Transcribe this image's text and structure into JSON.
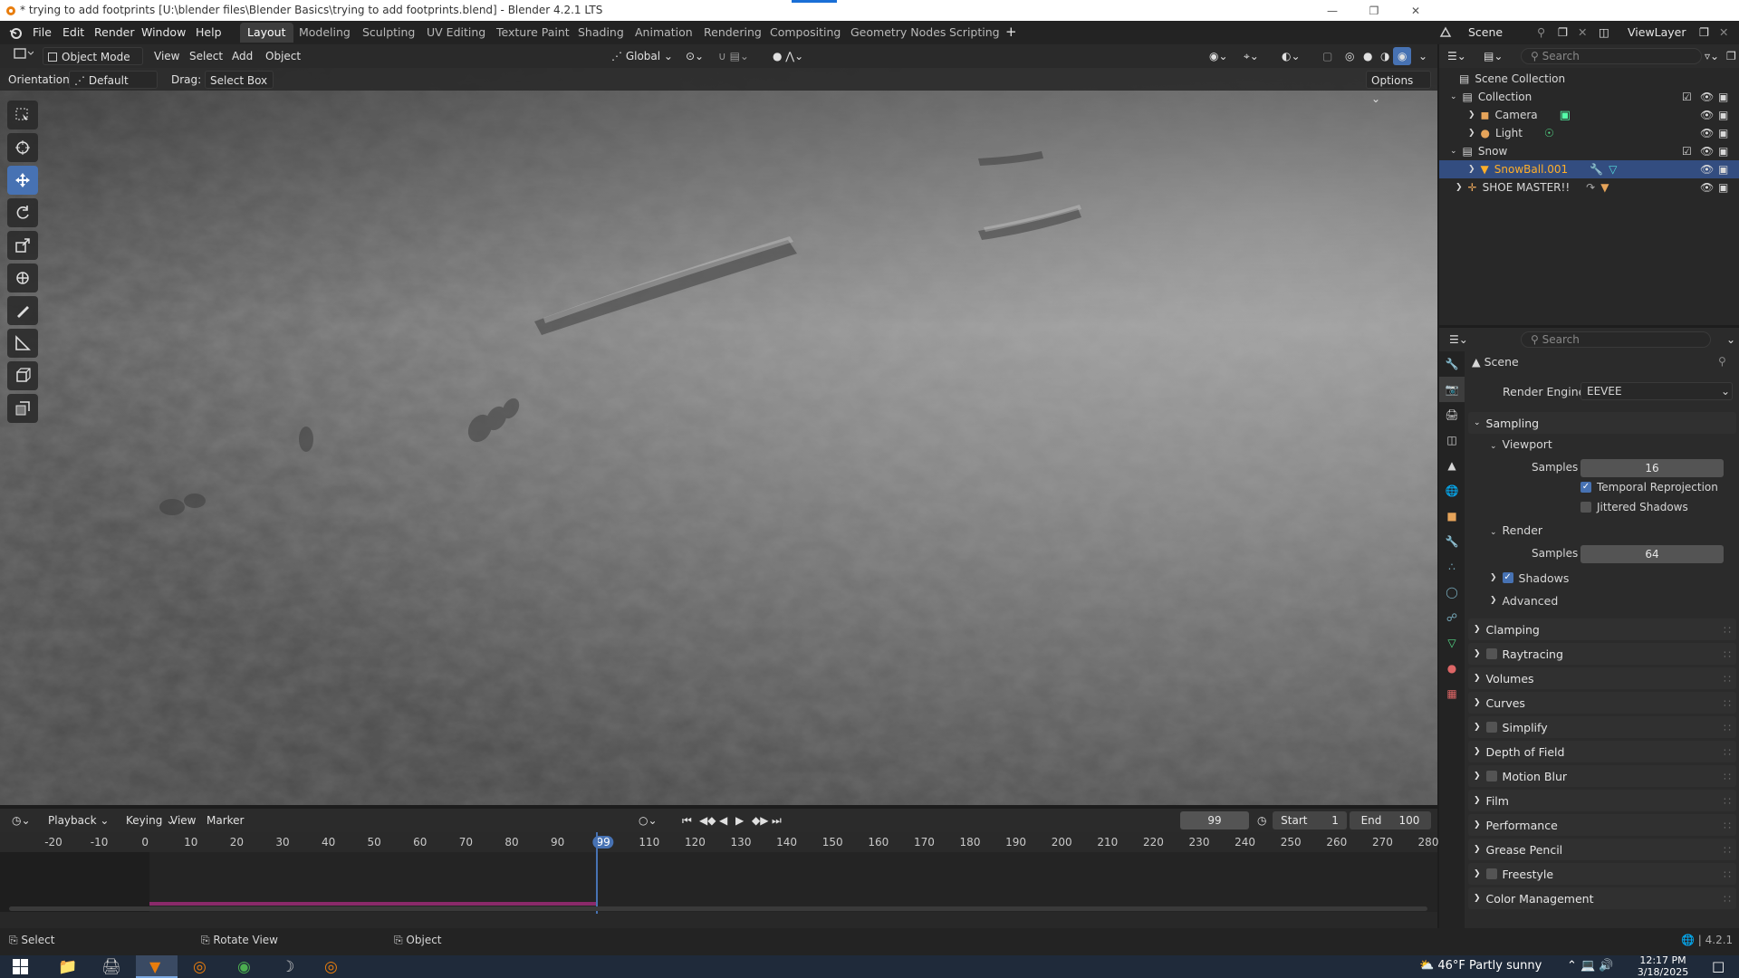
{
  "title_bar": {
    "title": "* trying to add footprints [U:\\blender files\\Blender Basics\\trying to add footprints.blend] - Blender 4.2.1 LTS"
  },
  "menu": [
    "File",
    "Edit",
    "Render",
    "Window",
    "Help"
  ],
  "workspaces": [
    "Layout",
    "Modeling",
    "Sculpting",
    "UV Editing",
    "Texture Paint",
    "Shading",
    "Animation",
    "Rendering",
    "Compositing",
    "Geometry Nodes",
    "Scripting"
  ],
  "scene_selector": {
    "scene": "Scene",
    "view_layer": "ViewLayer"
  },
  "viewport_header": {
    "mode": "Object Mode",
    "view": "View",
    "select": "Select",
    "add": "Add",
    "object": "Object",
    "transform_orientation": "Global",
    "options": "Options",
    "orientation_label": "Orientation:",
    "orientation_value": "Default",
    "drag_label": "Drag:",
    "drag_value": "Select Box"
  },
  "outliner": {
    "search_placeholder": "Search",
    "items": [
      {
        "label": "Scene Collection"
      },
      {
        "label": "Collection"
      },
      {
        "label": "Camera"
      },
      {
        "label": "Light"
      },
      {
        "label": "Snow"
      },
      {
        "label": "SnowBall.001"
      },
      {
        "label": "SHOE MASTER!!"
      }
    ]
  },
  "properties": {
    "search_placeholder": "Search",
    "context": "Scene",
    "render_engine_label": "Render Engine",
    "render_engine": "EEVEE",
    "sampling": "Sampling",
    "viewport": "Viewport",
    "samples_label": "Samples",
    "viewport_samples": "16",
    "temporal_reprojection": "Temporal Reprojection",
    "jittered_shadows": "Jittered Shadows",
    "render": "Render",
    "render_samples": "64",
    "shadows": "Shadows",
    "advanced": "Advanced",
    "panels": [
      "Clamping",
      "Raytracing",
      "Volumes",
      "Curves",
      "Simplify",
      "Depth of Field",
      "Motion Blur",
      "Film",
      "Performance",
      "Grease Pencil",
      "Freestyle",
      "Color Management"
    ]
  },
  "timeline": {
    "playback": "Playback",
    "keying": "Keying",
    "view": "View",
    "marker": "Marker",
    "current_frame": "99",
    "start_label": "Start",
    "start": "1",
    "end_label": "End",
    "end": "100",
    "ruler": [
      "-20",
      "-10",
      "0",
      "10",
      "20",
      "30",
      "40",
      "50",
      "60",
      "70",
      "80",
      "90",
      "99",
      "110",
      "120",
      "130",
      "140",
      "150",
      "160",
      "170",
      "180",
      "190",
      "200",
      "210",
      "220",
      "230",
      "240",
      "250",
      "260",
      "270",
      "280"
    ]
  },
  "status_bar": {
    "select": "Select",
    "rotate_view": "Rotate View",
    "object": "Object",
    "version": "4.2.1"
  },
  "taskbar": {
    "weather": "46°F  Partly sunny",
    "time": "12:17 PM",
    "date": "3/18/2025"
  },
  "colors": {
    "accent": "#4772b3",
    "selection": "#334d80",
    "orange_active": "#ffaf29",
    "keyframe_bar": "#8a2a6a"
  }
}
